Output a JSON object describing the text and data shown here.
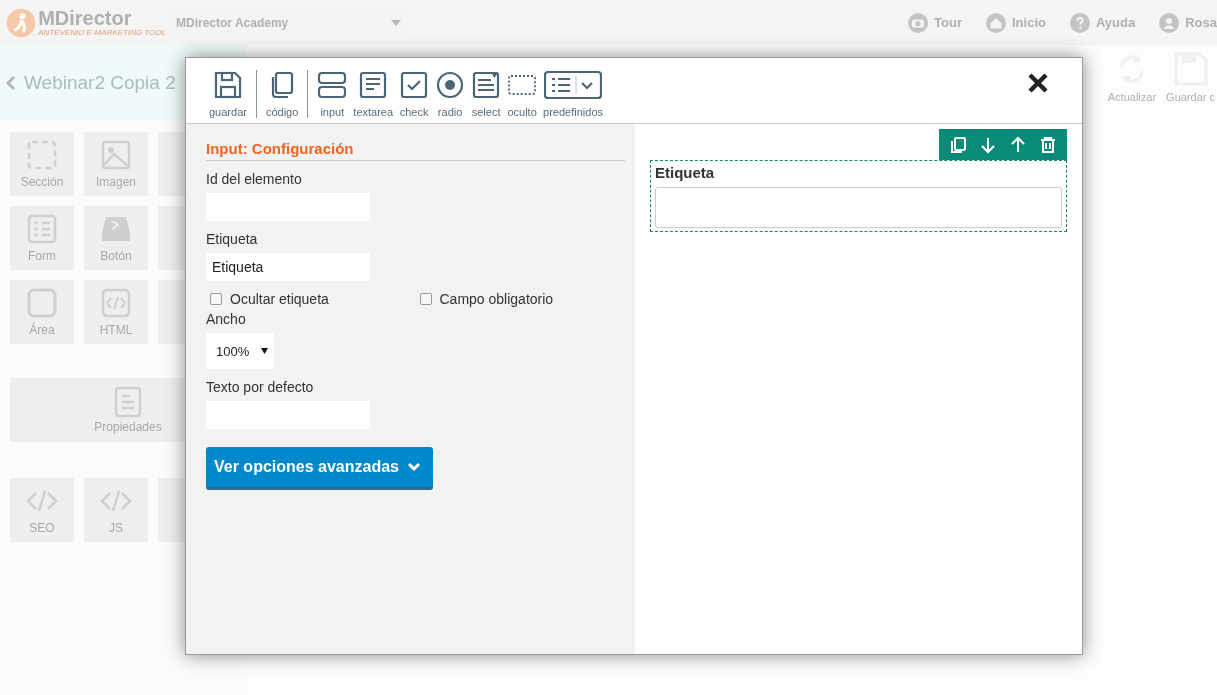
{
  "app_header": {
    "logo": "MDirector",
    "tagline": "ANTEVENIO E-MARKETING TOOL",
    "account": "MDirector Academy",
    "nav": [
      {
        "kind": "camera",
        "label": "Tour"
      },
      {
        "kind": "home",
        "label": "Inicio"
      },
      {
        "kind": "help",
        "label": "Ayuda"
      },
      {
        "kind": "user",
        "label": "Rosa"
      }
    ]
  },
  "campaign_bar": {
    "title": "Webinar2 Copia 2"
  },
  "blocks": [
    {
      "kind": "section",
      "label": "Sección"
    },
    {
      "kind": "image",
      "label": "Imagen"
    },
    {
      "kind": "form",
      "label": "Form"
    },
    {
      "kind": "button",
      "label": "Botón"
    },
    {
      "kind": "area",
      "label": "Área"
    },
    {
      "kind": "code",
      "label": "HTML"
    }
  ],
  "properties_block": {
    "label": "Propiedades"
  },
  "code_blocks": [
    {
      "label": "SEO"
    },
    {
      "label": "JS"
    }
  ],
  "editor_actions": [
    {
      "kind": "refresh",
      "label": "Actualizar"
    },
    {
      "kind": "save",
      "label": "Guardar c"
    }
  ],
  "modal": {
    "toolbar": [
      {
        "kind": "save",
        "label": "guardar",
        "separator_after": true
      },
      {
        "kind": "copy",
        "label": "código",
        "separator_after": true
      },
      {
        "kind": "input",
        "label": "input",
        "separator_after": false
      },
      {
        "kind": "textarea",
        "label": "textarea",
        "separator_after": false
      },
      {
        "kind": "check",
        "label": "check",
        "separator_after": false
      },
      {
        "kind": "radio",
        "label": "radio",
        "separator_after": false
      },
      {
        "kind": "select",
        "label": "select",
        "separator_after": false
      },
      {
        "kind": "hidden",
        "label": "oculto",
        "separator_after": false
      },
      {
        "kind": "presets",
        "label": "predefinidos",
        "separator_after": false
      }
    ],
    "config": {
      "title": "Input: Configuración",
      "fields": [
        {
          "kind": "text",
          "label": "Id del elemento"
        },
        {
          "kind": "text",
          "label": "Etiqueta",
          "value": "Etiqueta"
        },
        {
          "kind": "checkboxes",
          "options": [
            {
              "label": "Ocultar etiqueta",
              "checked": false
            },
            {
              "label": "Campo obligatorio",
              "checked": false
            }
          ]
        },
        {
          "kind": "select",
          "label": "Ancho",
          "value": "100%"
        },
        {
          "kind": "text",
          "label": "Texto por defecto"
        }
      ],
      "advanced_button": "Ver opciones avanzadas"
    },
    "preview": {
      "label": "Etiqueta"
    }
  }
}
